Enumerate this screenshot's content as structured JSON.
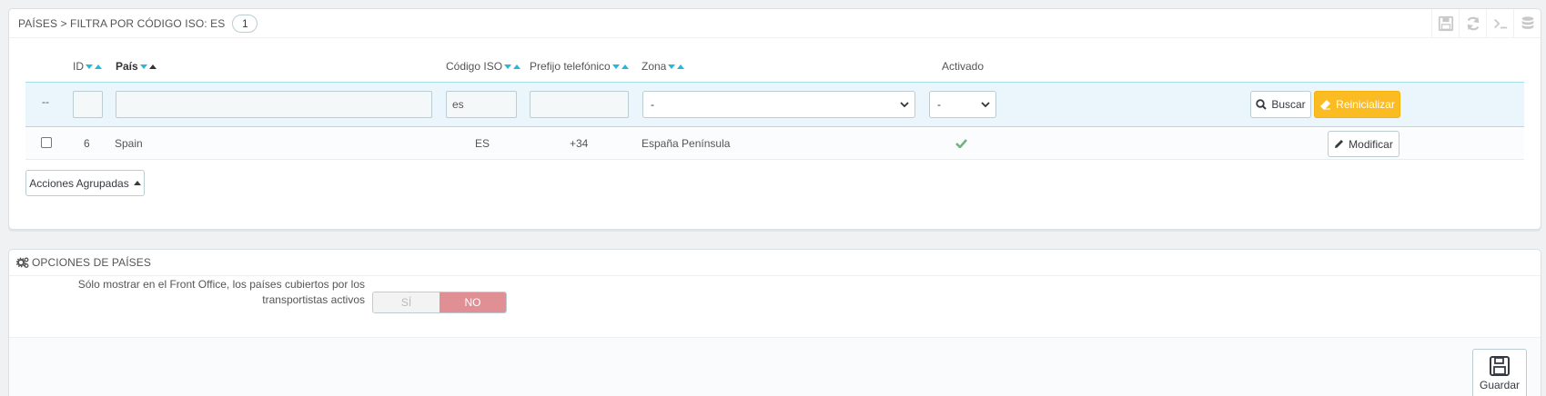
{
  "countries_panel": {
    "breadcrumb": "PAÍSES > FILTRA POR CÓDIGO ISO: ES",
    "count": "1",
    "tools": [
      "save-icon",
      "refresh-icon",
      "terminal-icon",
      "database-icon"
    ],
    "columns": {
      "id": "ID",
      "country": "País",
      "iso": "Código ISO",
      "prefix": "Prefijo telefónico",
      "zone": "Zona",
      "enabled": "Activado"
    },
    "filters": {
      "select_all": "--",
      "id_value": "",
      "country_value": "",
      "iso_value": "es",
      "prefix_value": "",
      "zone_selected": "-",
      "enabled_selected": "-"
    },
    "search_label": "Buscar",
    "reset_label": "Reinicializar",
    "rows": [
      {
        "id": "6",
        "country": "Spain",
        "iso": "ES",
        "prefix": "+34",
        "zone": "España Península",
        "enabled": true,
        "action": "Modificar"
      }
    ],
    "bulk_actions_label": "Acciones Agrupadas"
  },
  "options_panel": {
    "title": "OPCIONES DE PAÍSES",
    "option_label": "Sólo mostrar en el Front Office, los países cubiertos por los transportistas activos",
    "switch_yes": "SÍ",
    "switch_no": "NO",
    "switch_value": "NO",
    "save_label": "Guardar"
  },
  "colors": {
    "accent": "#25b9d7",
    "warning": "#fbbb22",
    "success": "#70b580",
    "danger_switch": "#e08f95"
  }
}
